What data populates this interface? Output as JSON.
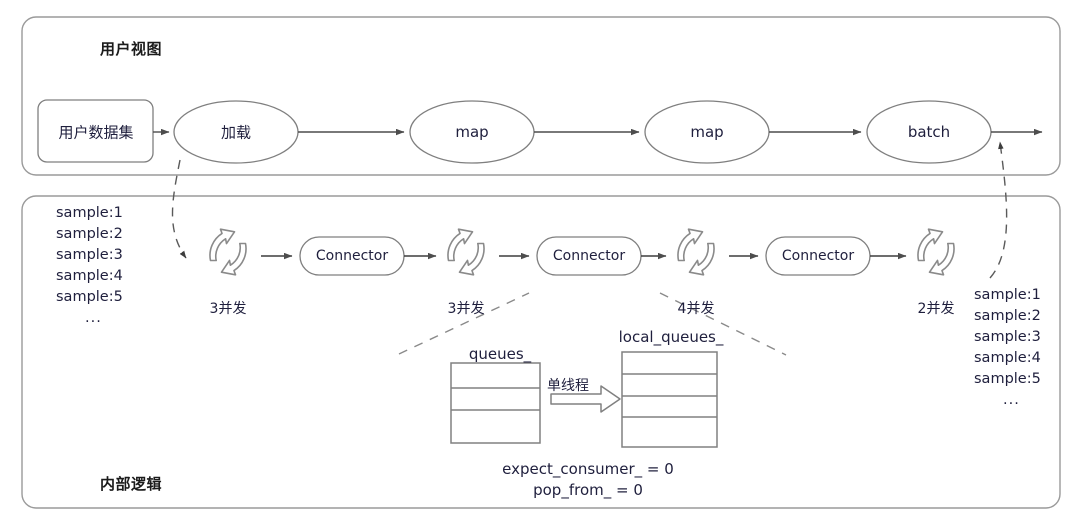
{
  "diagram": {
    "panels": [
      {
        "id": "user-view",
        "title": "用户视图"
      },
      {
        "id": "internal-logic",
        "title": "内部逻辑"
      }
    ],
    "user_view": {
      "dataset_box": {
        "label": "用户数据集"
      },
      "stages": [
        {
          "label": "加载"
        },
        {
          "label": "map"
        },
        {
          "label": "map"
        },
        {
          "label": "batch"
        }
      ]
    },
    "internal_logic": {
      "input_samples": {
        "items": [
          "sample:1",
          "sample:2",
          "sample:3",
          "sample:4",
          "sample:5"
        ],
        "ellipsis": "..."
      },
      "output_samples": {
        "items": [
          "sample:1",
          "sample:2",
          "sample:3",
          "sample:4",
          "sample:5"
        ],
        "ellipsis": "..."
      },
      "pipeline": [
        {
          "type": "loop",
          "caption": "3并发"
        },
        {
          "type": "connector",
          "label": "Connector"
        },
        {
          "type": "loop",
          "caption": "3并发"
        },
        {
          "type": "connector",
          "label": "Connector"
        },
        {
          "type": "loop",
          "caption": "4并发"
        },
        {
          "type": "connector",
          "label": "Connector"
        },
        {
          "type": "loop",
          "caption": "2并发"
        }
      ],
      "detail": {
        "queues_title": "queues_",
        "queues_rows": 3,
        "local_queues_title": "local_queues_",
        "local_queues_rows": 4,
        "transfer_label": "单线程",
        "stats": [
          "expect_consumer_ = 0",
          "pop_from_ = 0"
        ]
      }
    },
    "colors": {
      "stroke": "#7f7f7f",
      "text": "#1f1f3d",
      "title": "#1b1b1b",
      "arrow": "#4d4d4d",
      "background": "#ffffff"
    }
  }
}
